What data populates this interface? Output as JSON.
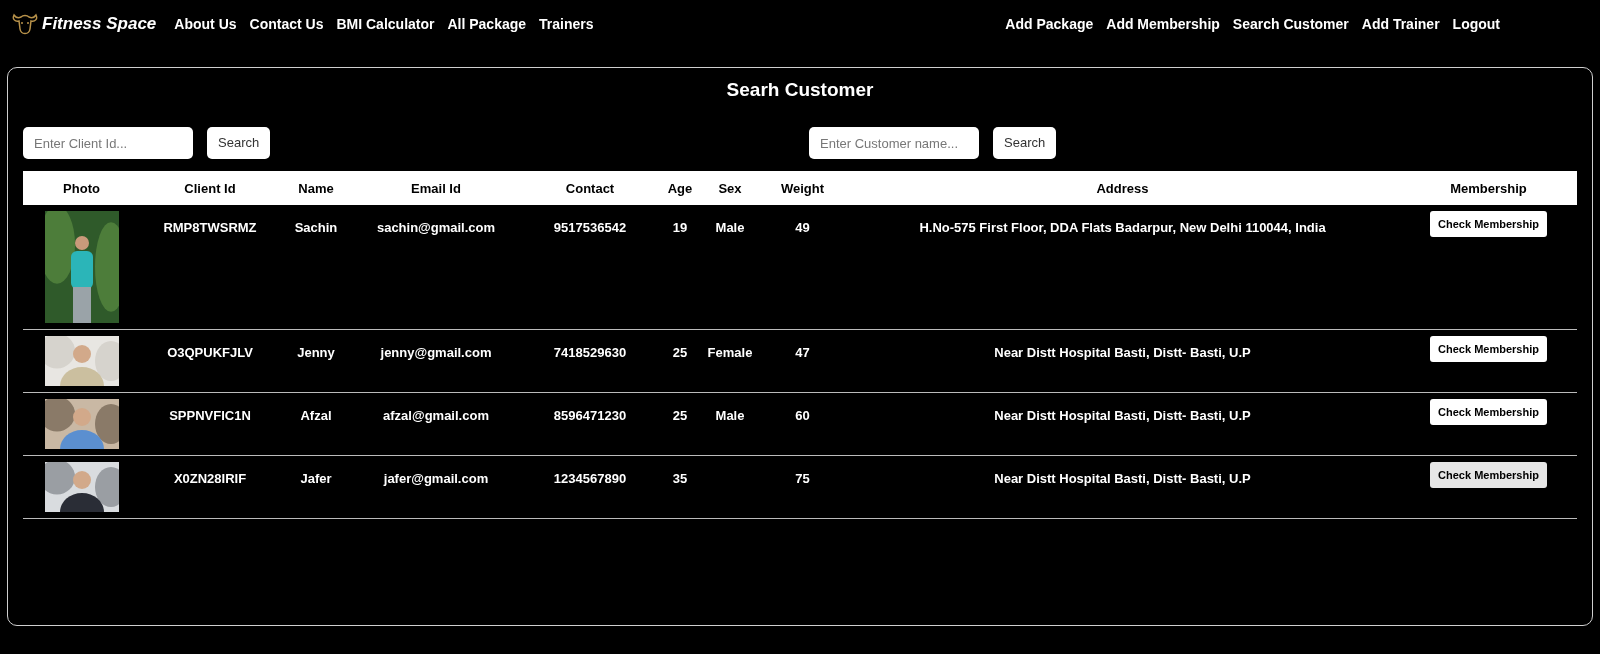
{
  "nav": {
    "brand": "Fitness Space",
    "left_links": [
      "About Us",
      "Contact Us",
      "BMI Calculator",
      "All Package",
      "Trainers"
    ],
    "right_links": [
      "Add Package",
      "Add Membership",
      "Search Customer",
      "Add Trainer",
      "Logout"
    ]
  },
  "title": "Searh Customer",
  "search_by_id": {
    "placeholder": "Enter Client Id...",
    "button": "Search"
  },
  "search_by_name": {
    "placeholder": "Enter Customer name...",
    "button": "Search"
  },
  "table": {
    "columns": [
      "Photo",
      "Client Id",
      "Name",
      "Email Id",
      "Contact",
      "Age",
      "Sex",
      "Weight",
      "Address",
      "Membership"
    ],
    "rows": [
      {
        "client_id": "RMP8TWSRMZ",
        "name": "Sachin",
        "email": "sachin@gmail.com",
        "contact": "9517536542",
        "age": "19",
        "sex": "Male",
        "weight": "49",
        "address": "H.No-575 First Floor, DDA Flats Badarpur, New Delhi 110044, India",
        "button": "Check Membership",
        "hovered": false
      },
      {
        "client_id": "O3QPUKFJLV",
        "name": "Jenny",
        "email": "jenny@gmail.com",
        "contact": "7418529630",
        "age": "25",
        "sex": "Female",
        "weight": "47",
        "address": "Near Distt Hospital Basti, Distt- Basti, U.P",
        "button": "Check Membership",
        "hovered": false
      },
      {
        "client_id": "SPPNVFIC1N",
        "name": "Afzal",
        "email": "afzal@gmail.com",
        "contact": "8596471230",
        "age": "25",
        "sex": "Male",
        "weight": "60",
        "address": "Near Distt Hospital Basti, Distt- Basti, U.P",
        "button": "Check Membership",
        "hovered": false
      },
      {
        "client_id": "X0ZN28IRIF",
        "name": "Jafer",
        "email": "jafer@gmail.com",
        "contact": "1234567890",
        "age": "35",
        "weight": "75",
        "address": "Near Distt Hospital Basti, Distt- Basti, U.P",
        "button": "Check Membership",
        "hovered": true
      }
    ]
  }
}
